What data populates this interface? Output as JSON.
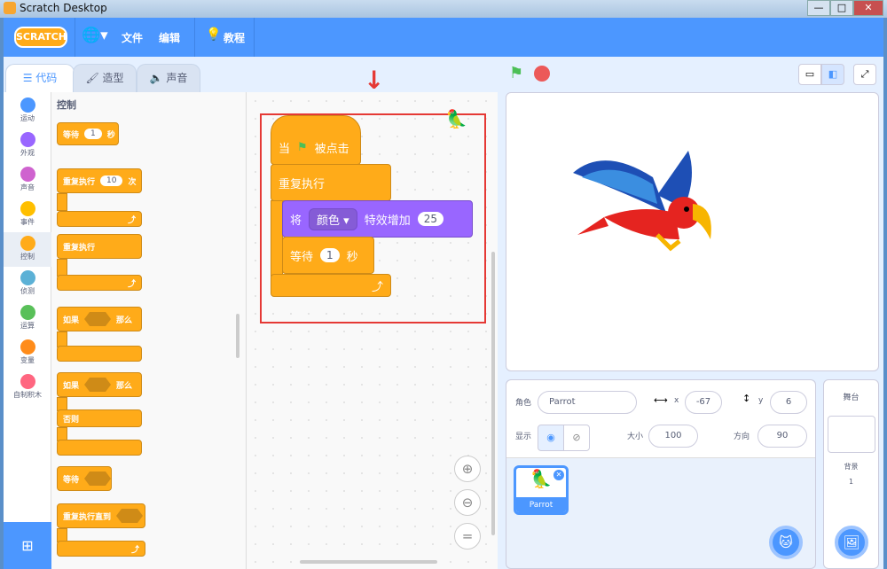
{
  "window": {
    "title": "Scratch Desktop",
    "min": "—",
    "max": "□",
    "close": "✕"
  },
  "menu": {
    "logo": "SCRATCH",
    "file": "文件",
    "edit": "编辑",
    "tutorials": "教程"
  },
  "tabs": [
    {
      "label": "代码"
    },
    {
      "label": "造型"
    },
    {
      "label": "声音"
    }
  ],
  "categories": [
    {
      "label": "运动",
      "color": "#4c97ff"
    },
    {
      "label": "外观",
      "color": "#9966ff"
    },
    {
      "label": "声音",
      "color": "#cf63cf"
    },
    {
      "label": "事件",
      "color": "#ffbf00"
    },
    {
      "label": "控制",
      "color": "#ffab19"
    },
    {
      "label": "侦测",
      "color": "#5cb1d6"
    },
    {
      "label": "运算",
      "color": "#59c059"
    },
    {
      "label": "变量",
      "color": "#ff8c1a"
    },
    {
      "label": "自制积木",
      "color": "#ff6680"
    }
  ],
  "palette": {
    "heading": "控制",
    "wait": {
      "label": "等待",
      "value": "1",
      "unit": "秒"
    },
    "repeat": {
      "label": "重复执行",
      "value": "10",
      "unit": "次"
    },
    "forever": "重复执行",
    "if": {
      "label": "如果",
      "then": "那么"
    },
    "ifelse": {
      "label": "如果",
      "then": "那么",
      "else": "否则"
    },
    "waituntil": "等待",
    "repeatuntil": "重复执行直到"
  },
  "script": {
    "hat": {
      "prefix": "当",
      "suffix": "被点击"
    },
    "forever": "重复执行",
    "effect": {
      "label": "将",
      "dropdown": "颜色",
      "action": "特效增加",
      "value": "25"
    },
    "wait": {
      "label": "等待",
      "value": "1",
      "unit": "秒"
    },
    "arrow": "↓"
  },
  "sprite": {
    "label_sprite": "角色",
    "name": "Parrot",
    "x_label": "x",
    "x": "-67",
    "y_label": "y",
    "y": "6",
    "show_label": "显示",
    "size_label": "大小",
    "size": "100",
    "direction_label": "方向",
    "direction": "90",
    "thumb_name": "Parrot"
  },
  "stagepanel": {
    "title": "舞台",
    "backdrop_label": "背景",
    "backdrop_count": "1"
  },
  "colors": {
    "accent": "#4c97ff",
    "control": "#ffab19",
    "looks": "#9966ff",
    "highlight": "#e53935"
  }
}
